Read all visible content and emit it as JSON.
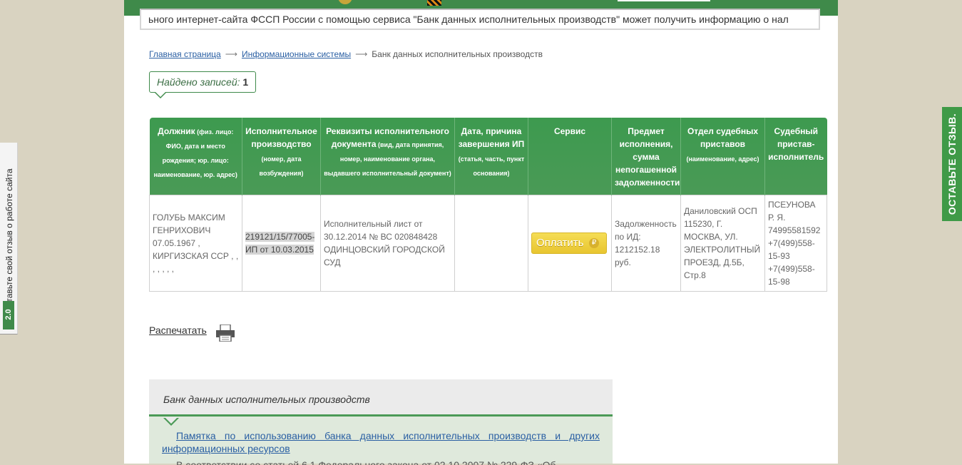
{
  "marquee_text": "ьного интернет-сайта ФССП России с помощью сервиса \"Банк данных исполнительных производств\" может получить информацию о нал",
  "breadcrumb": {
    "home": "Главная страница",
    "arrow": "⟶",
    "systems": "Информационные системы",
    "current": "Банк данных исполнительных производств"
  },
  "found": {
    "label": "Найдено записей: ",
    "count": "1"
  },
  "table": {
    "headers": [
      {
        "title": "Должник",
        "sub": " (физ. лицо: ФИО, дата и место рождения; юр. лицо: наименование, юр. адрес)"
      },
      {
        "title": "Исполнительное производство",
        "sub": " (номер, дата возбуждения)"
      },
      {
        "title": "Реквизиты исполнительного документа",
        "sub": " (вид, дата принятия, номер, наименование органа, выдавшего исполнительный документ)"
      },
      {
        "title": "Дата, причина завершения ИП",
        "sub": " (статья, часть, пункт основания)"
      },
      {
        "title": "Сервис",
        "sub": ""
      },
      {
        "title": "Предмет исполнения, сумма непогашенной задолженности",
        "sub": ""
      },
      {
        "title": "Отдел судебных приставов",
        "sub": " (наименование, адрес)"
      },
      {
        "title": "Судебный пристав-исполнитель",
        "sub": ""
      }
    ],
    "row": {
      "debtor": "ГОЛУБЬ МАКСИМ ГЕНРИХОВИЧ 07.05.1967 , КИРГИЗСКАЯ ССР , , , , , , ,",
      "proceeding": "219121/15/77005-ИП от 10.03.2015",
      "document": "Исполнительный лист от 30.12.2014 № ВС 020848428 ОДИНЦОВСКИЙ ГОРОДСКОЙ СУД",
      "completion": "",
      "pay_button": "Оплатить",
      "ruble_sign": "₽",
      "subject": "Задолженность по ИД: 1212152.18 руб.",
      "department": "Даниловский ОСП 115230, Г. МОСКВА, УЛ. ЭЛЕКТРОЛИТНЫЙ ПРОЕЗД, Д.5Б, Стр.8",
      "bailiff": "ПСЕУНОВА Р. Я. 74995581592 +7(499)558-15-93 +7(499)558-15-98"
    }
  },
  "print_label": "Распечатать",
  "info_panel": {
    "title": "Банк данных исполнительных производств",
    "link": "Памятка по использованию банка данных исполнительных производств и других информационных ресурсов",
    "more_text": "В соответствии со статьей 6.1 Федерального закона от 02.10.2007 № 229-ФЗ «Об"
  },
  "left_tab": {
    "text": "Оставьте свой отзыв о работе сайта",
    "badge": "2.0"
  },
  "right_tab": {
    "text": "ОСТАВЬТЕ ОТЗЫВ."
  },
  "colors": {
    "brand_green": "#3f8a4a",
    "header_green": "#4a9a56",
    "pay_yellow": "#f0d040",
    "link_blue": "#2a5fa3"
  },
  "icons": [
    "printer-icon",
    "ruble-icon",
    "arrow-icon"
  ]
}
